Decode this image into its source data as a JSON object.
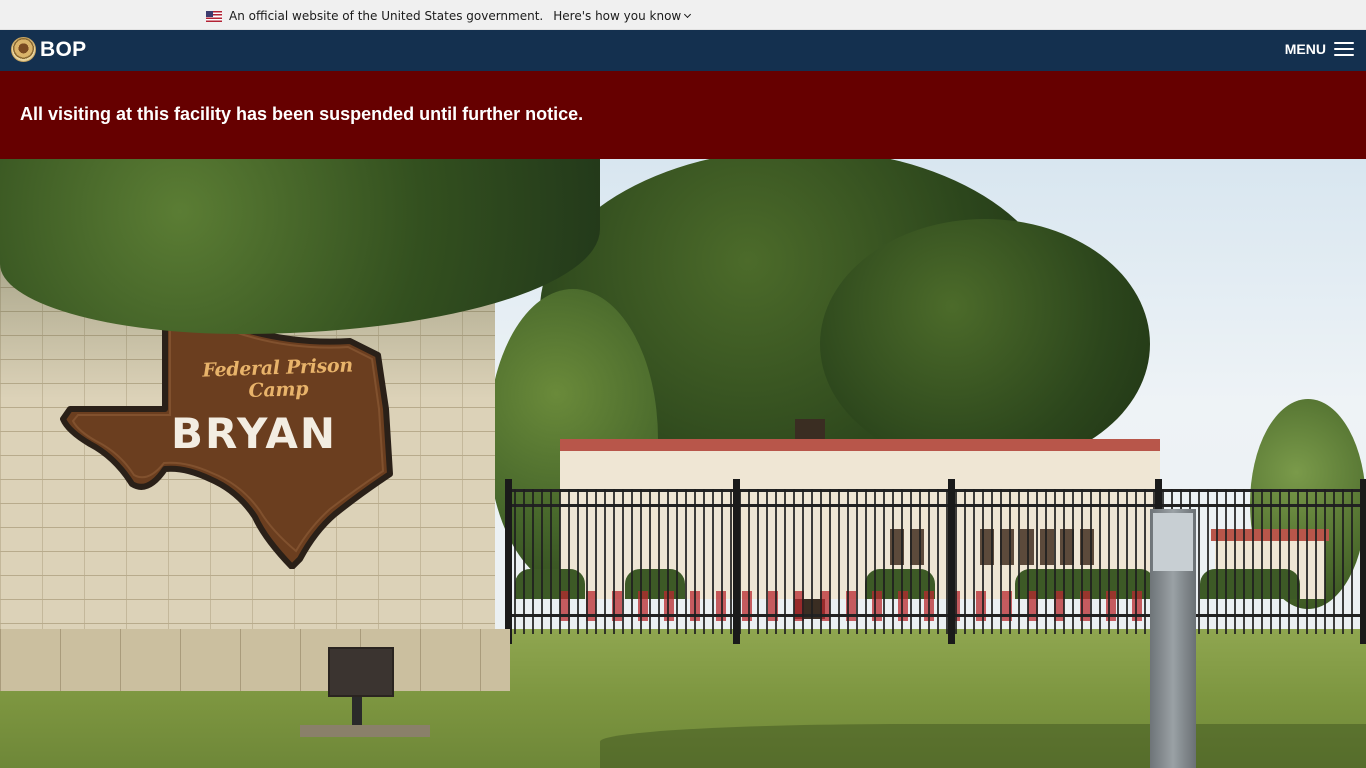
{
  "gov_banner": {
    "official_text": "An official website of the United States government.",
    "how_you_know_label": "Here's how you know",
    "flag_icon": "us-flag-icon",
    "chevron_icon": "chevron-down-icon"
  },
  "header": {
    "logo_text": "BOP",
    "logo_icon": "bop-seal-icon",
    "menu_label": "MENU",
    "menu_icon": "hamburger-icon",
    "background_color": "#14304f"
  },
  "alert": {
    "message": "All visiting at this facility has been suspended until further notice.",
    "background_color": "#660000"
  },
  "hero": {
    "sign": {
      "subtitle": "Federal Prison Camp",
      "name": "BRYAN"
    }
  }
}
